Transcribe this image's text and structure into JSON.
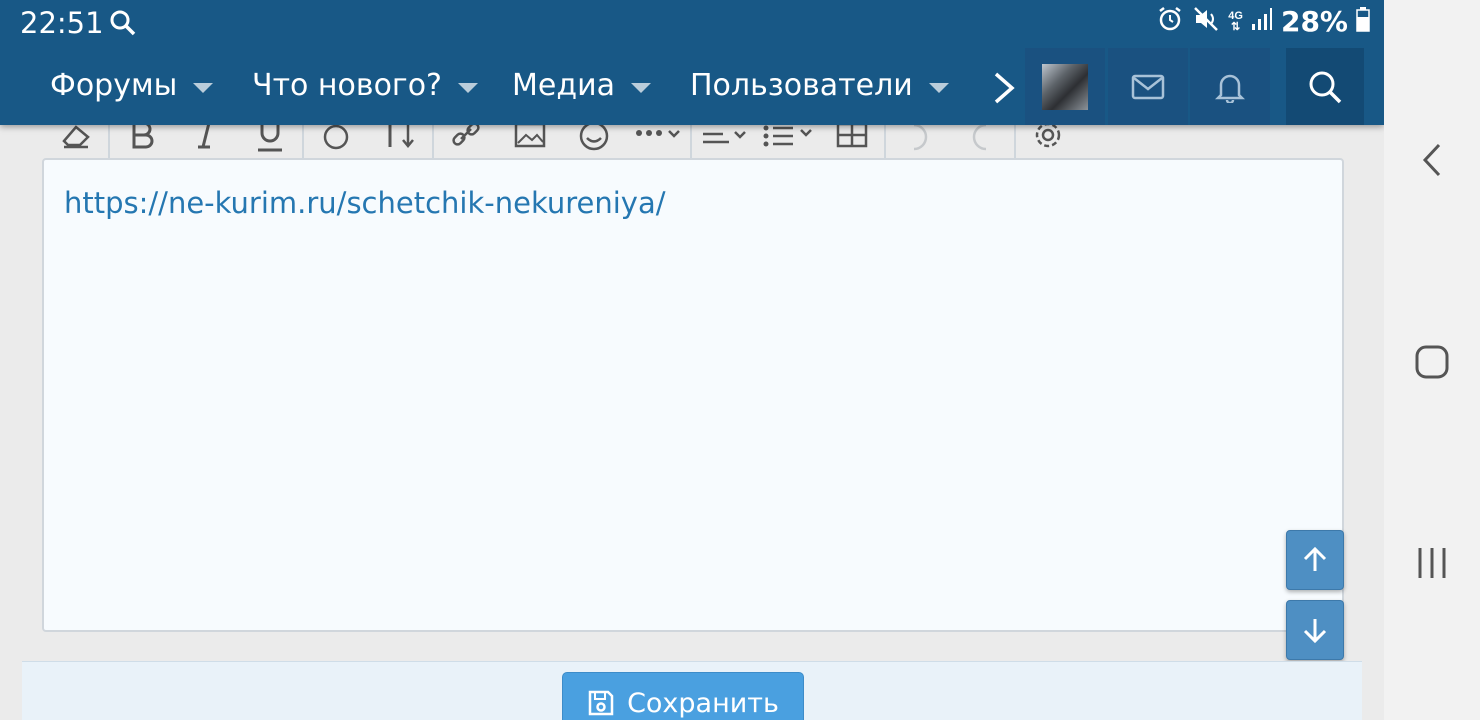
{
  "status_bar": {
    "time": "22:51",
    "network": "4G",
    "battery": "28%"
  },
  "nav": {
    "items": [
      {
        "label": "Форумы"
      },
      {
        "label": "Что нового?"
      },
      {
        "label": "Медиа"
      },
      {
        "label": "Пользователи"
      }
    ]
  },
  "editor": {
    "content_link": "https://ne-kurim.ru/schetchik-nekureniya/"
  },
  "footer": {
    "save_label": "Сохранить"
  },
  "colors": {
    "header": "#185886",
    "link": "#2577b1",
    "save_button": "#4aa0e0"
  }
}
